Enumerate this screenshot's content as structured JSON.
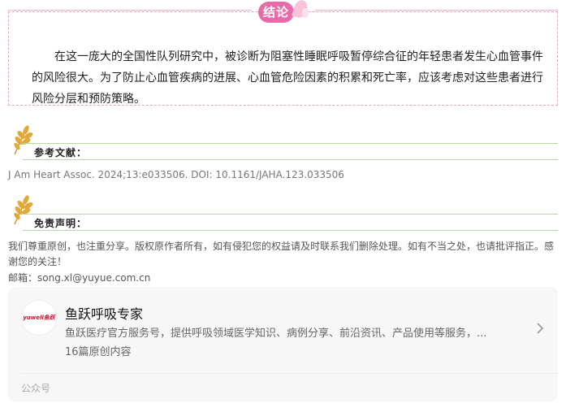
{
  "conclusion": {
    "badge": "结论",
    "text": "在这一庞大的全国性队列研究中，被诊断为阻塞性睡眠呼吸暂停综合征的年轻患者发生心血管事件的风险很大。为了防止心血管疾病的进展、心血管危险因素的积累和死亡率，应该考虑对这些患者进行风险分层和预防策略。"
  },
  "references": {
    "title": "参考文献：",
    "citation": "J Am Heart Assoc. 2024;13:e033506. DOI: 10.1161/JAHA.123.033506"
  },
  "disclaimer_section": {
    "title": "免责声明：",
    "text": "我们尊重原创，也注重分享。版权原作者所有，如有侵犯您的权益请及时联系我们删除处理。如有不当之处，也请批评指正。感谢您的关注！",
    "email": "邮箱：song.xl@yuyue.com.cn"
  },
  "account_card": {
    "logo_text": "yuwell鱼跃",
    "name": "鱼跃呼吸专家",
    "description": "鱼跃医疗官方服务号，提供呼吸领域医学知识、病例分享、前沿资讯、产品使用等服务，...",
    "count": "16篇原创内容",
    "footer": "公众号"
  },
  "colors": {
    "accent_pink": "#e86aa8",
    "line_green": "#b8d8a6",
    "wheat": "#e0a93a"
  },
  "icons": [
    "wheat-icon",
    "chevron-right-icon"
  ]
}
